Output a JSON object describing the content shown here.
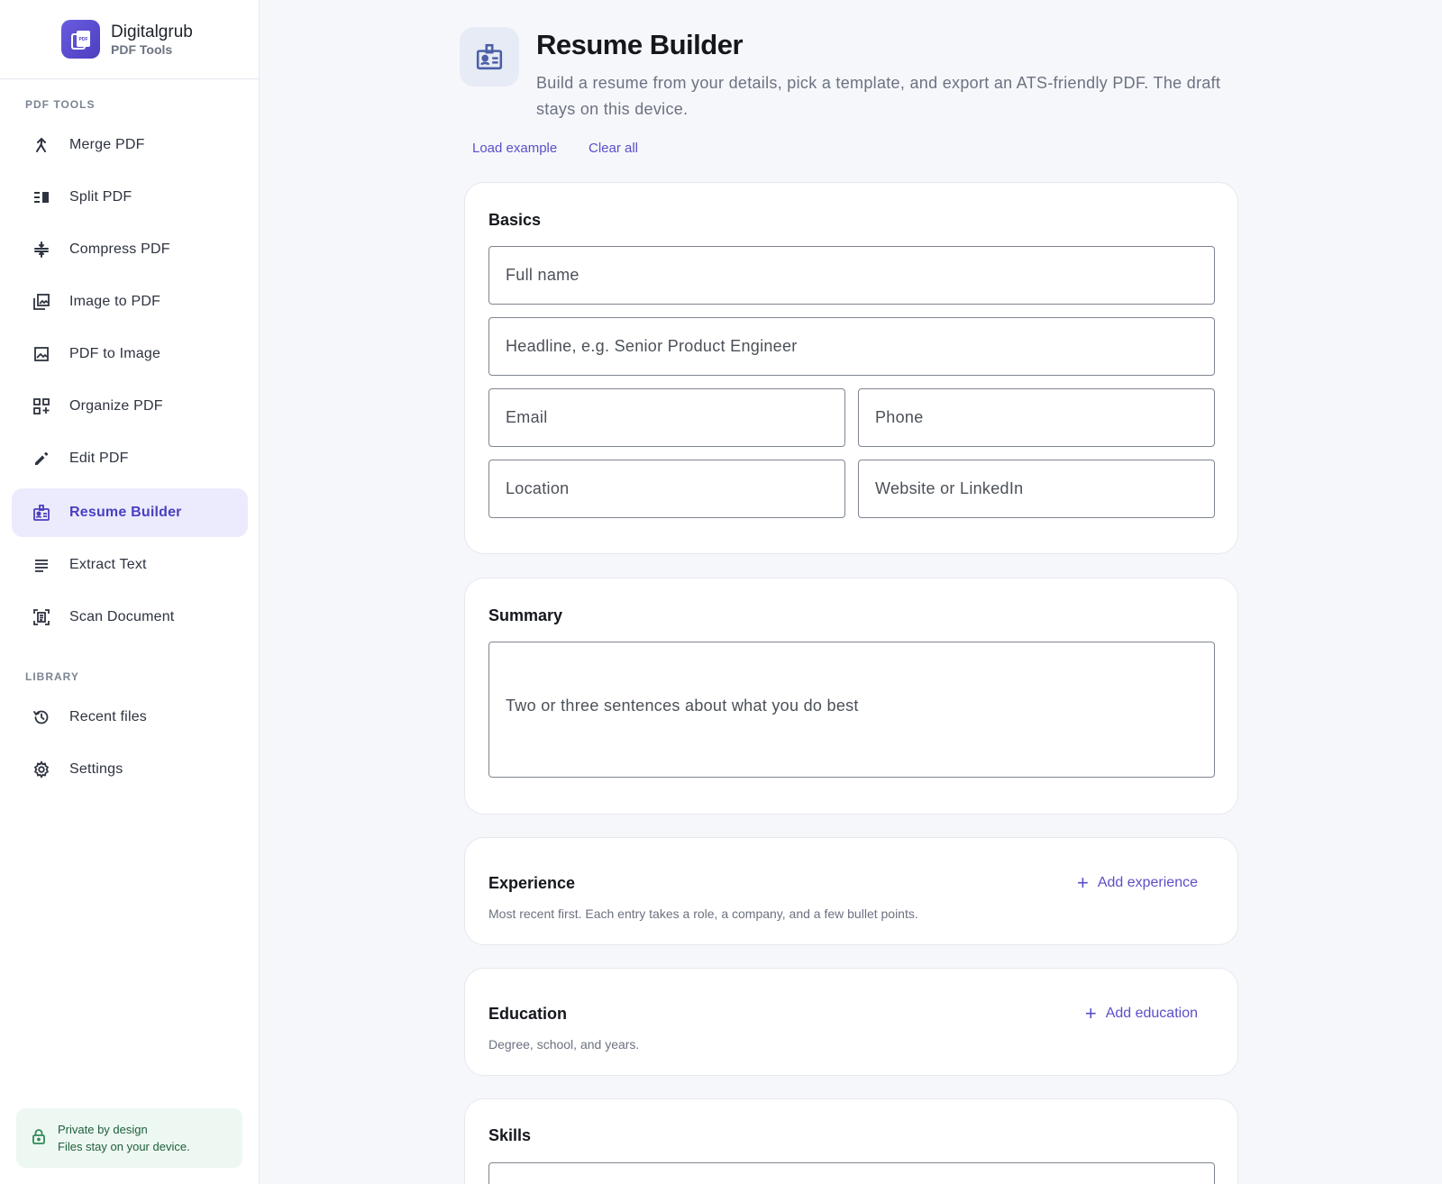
{
  "brand": {
    "name": "Digitalgrub",
    "subtitle": "PDF Tools",
    "logo_text": "PDF"
  },
  "sidebar": {
    "section_tools": "PDF TOOLS",
    "section_library": "LIBRARY",
    "tools": [
      {
        "label": "Merge PDF",
        "icon": "merge-icon"
      },
      {
        "label": "Split PDF",
        "icon": "split-icon"
      },
      {
        "label": "Compress PDF",
        "icon": "compress-icon"
      },
      {
        "label": "Image to PDF",
        "icon": "image-stack-icon"
      },
      {
        "label": "PDF to Image",
        "icon": "image-icon"
      },
      {
        "label": "Organize PDF",
        "icon": "grid-add-icon"
      },
      {
        "label": "Edit PDF",
        "icon": "pencil-icon"
      },
      {
        "label": "Resume Builder",
        "icon": "id-badge-icon",
        "active": true
      },
      {
        "label": "Extract Text",
        "icon": "lines-icon"
      },
      {
        "label": "Scan Document",
        "icon": "scan-icon"
      }
    ],
    "library": [
      {
        "label": "Recent files",
        "icon": "history-icon"
      },
      {
        "label": "Settings",
        "icon": "gear-icon"
      }
    ],
    "privacy": {
      "line1": "Private by design",
      "line2": "Files stay on your device."
    }
  },
  "header": {
    "title": "Resume Builder",
    "description": "Build a resume from your details, pick a template, and export an ATS-friendly PDF. The draft stays on this device.",
    "load_example": "Load example",
    "clear_all": "Clear all"
  },
  "basics": {
    "title": "Basics",
    "full_name": {
      "value": "",
      "placeholder": "Full name"
    },
    "headline": {
      "value": "",
      "placeholder": "Headline, e.g. Senior Product Engineer"
    },
    "email": {
      "value": "",
      "placeholder": "Email"
    },
    "phone": {
      "value": "",
      "placeholder": "Phone"
    },
    "location": {
      "value": "",
      "placeholder": "Location"
    },
    "website": {
      "value": "",
      "placeholder": "Website or LinkedIn"
    }
  },
  "summary": {
    "title": "Summary",
    "text": {
      "value": "",
      "placeholder": "Two or three sentences about what you do best"
    }
  },
  "experience": {
    "title": "Experience",
    "subtitle": "Most recent first. Each entry takes a role, a company, and a few bullet points.",
    "add_label": "Add experience"
  },
  "education": {
    "title": "Education",
    "subtitle": "Degree, school, and years.",
    "add_label": "Add education"
  },
  "skills": {
    "title": "Skills"
  },
  "colors": {
    "accent": "#4b3fbf",
    "active_bg": "#ecebfd",
    "privacy_bg": "#eef8f2"
  }
}
